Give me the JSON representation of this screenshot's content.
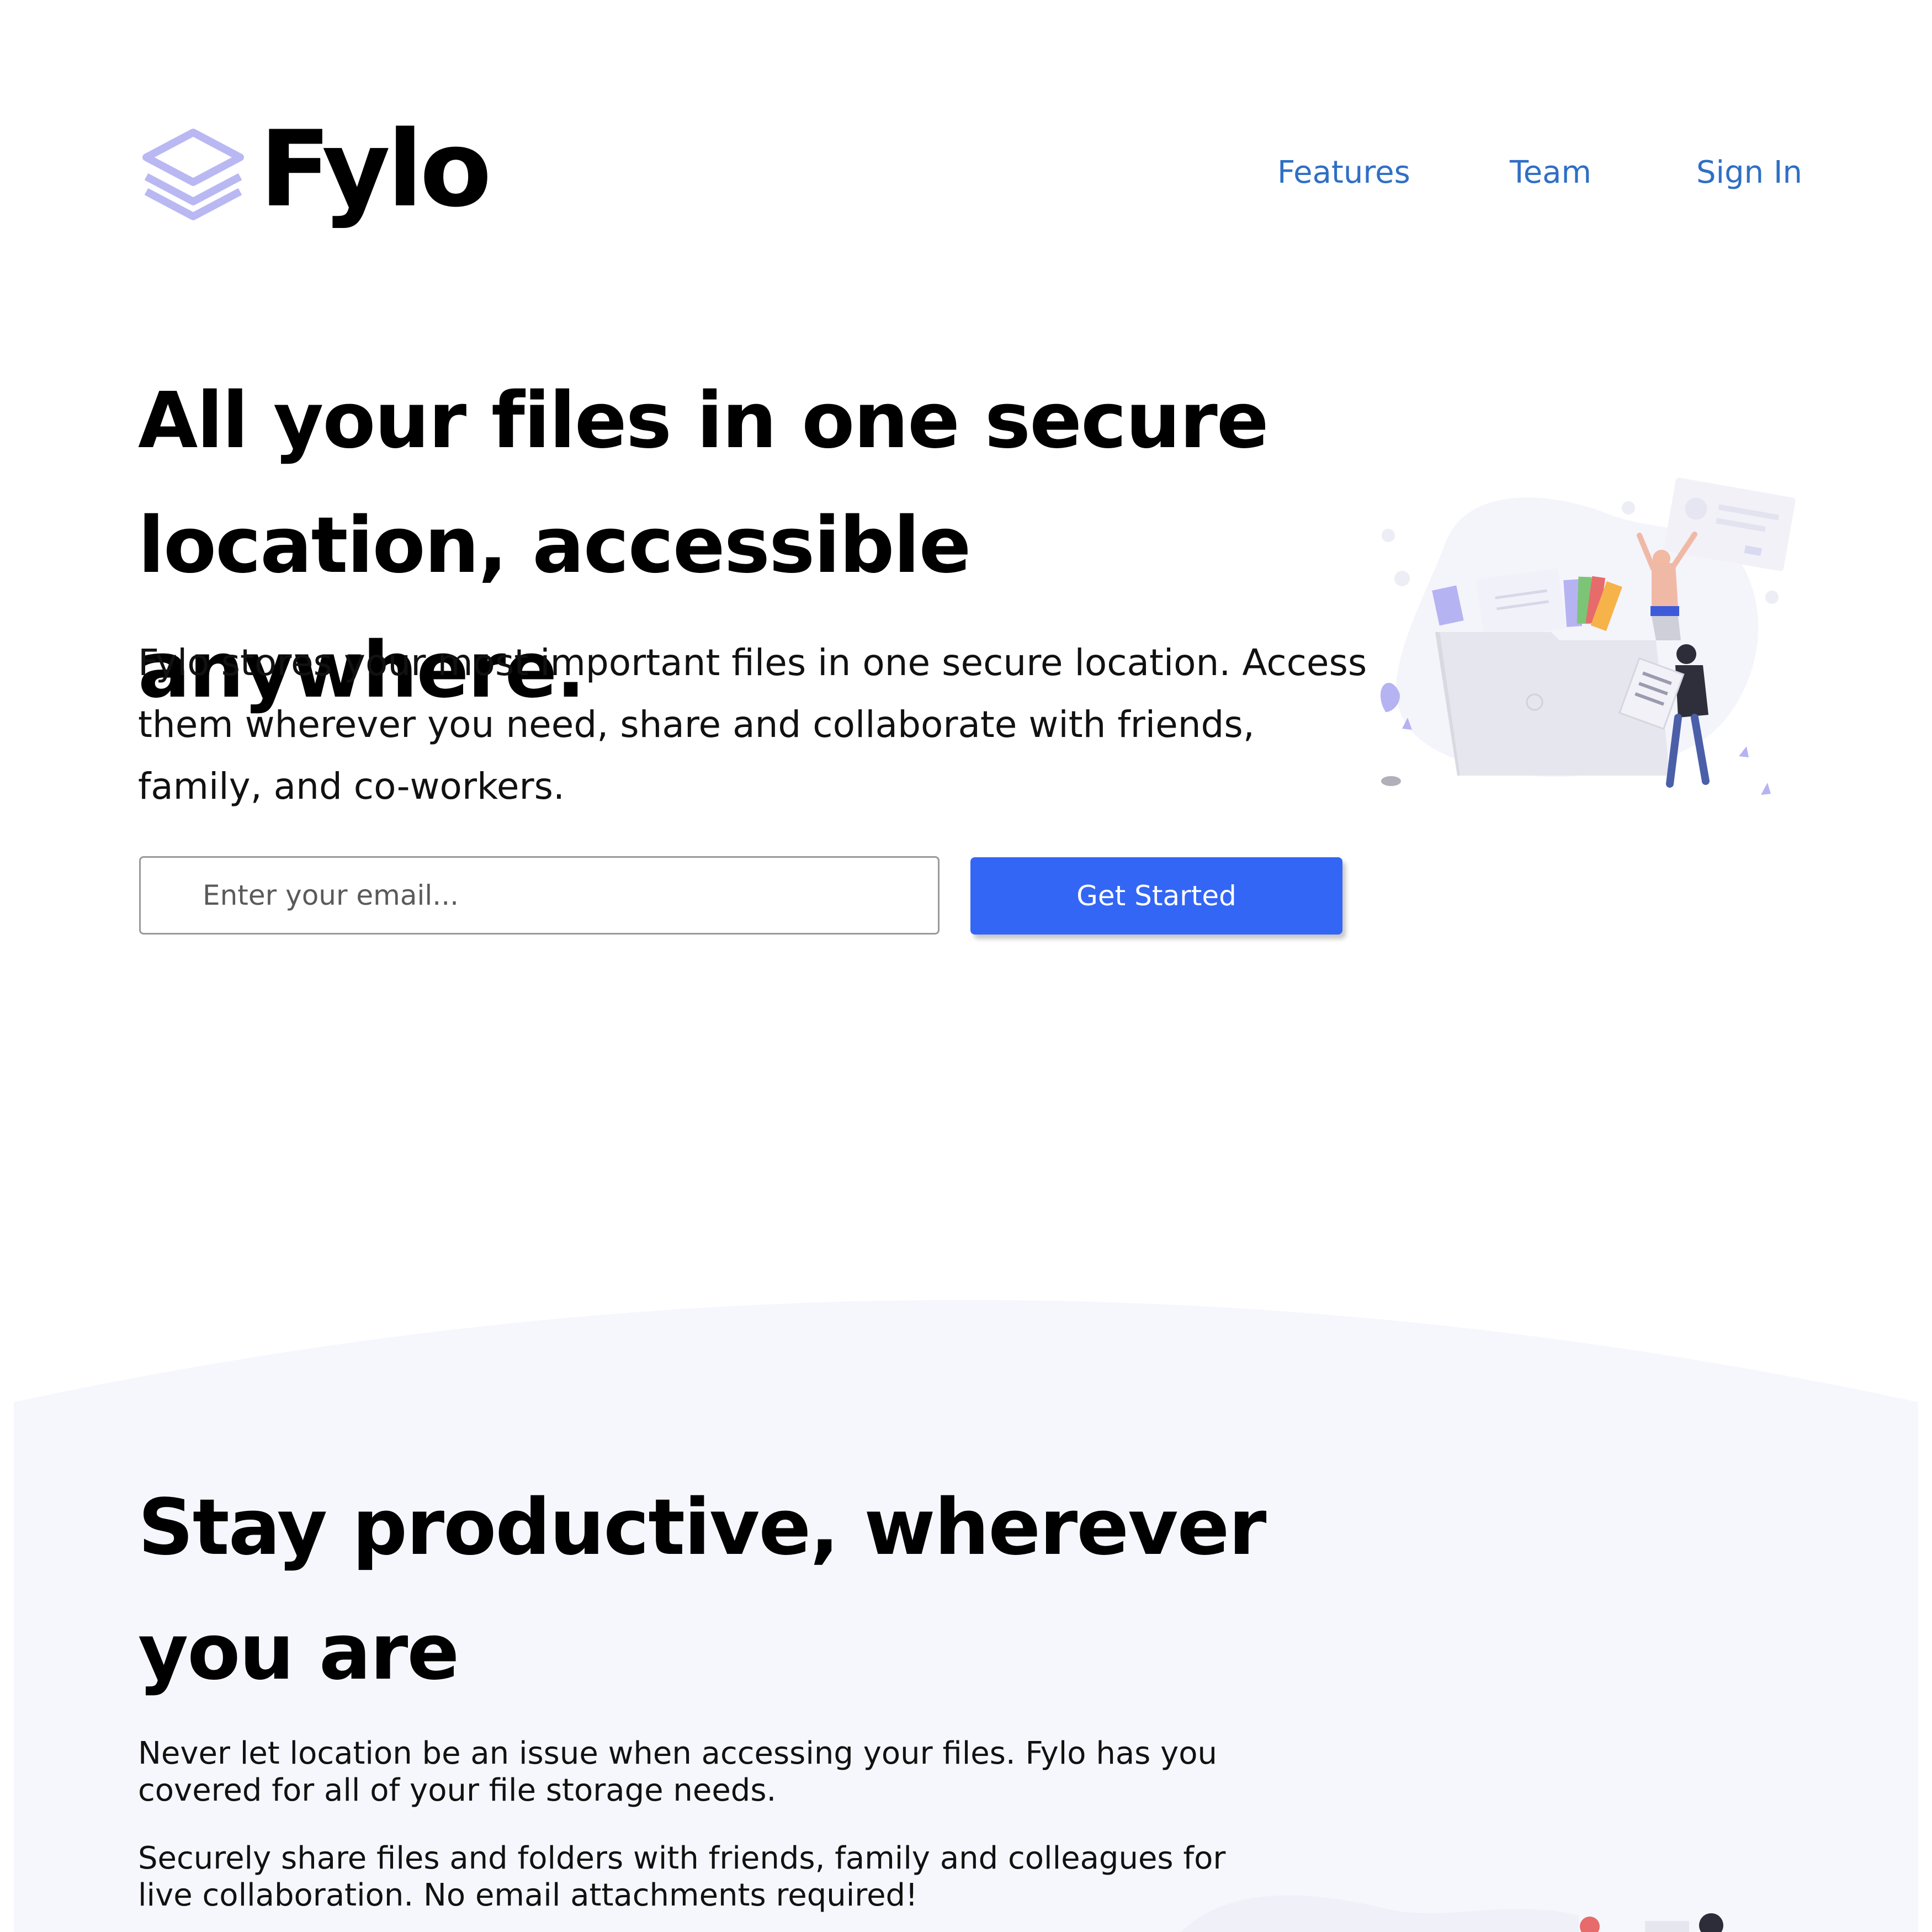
{
  "brand": {
    "name": "Fylo",
    "logo_icon": "stacked-layers-icon",
    "logo_color": "#b9b8f3"
  },
  "nav": {
    "items": [
      {
        "label": "Features"
      },
      {
        "label": "Team"
      },
      {
        "label": "Sign In"
      }
    ],
    "link_color": "#2f6fc5"
  },
  "hero": {
    "title": "All your files in one secure location, accessible anywhere.",
    "description": "Fylo stores your most important files in one secure location. Access them wherever you need, share and collaborate with friends, family, and co-workers.",
    "email_placeholder": "Enter your email...",
    "email_value": "",
    "cta_label": "Get Started",
    "cta_color": "#3366f5",
    "illustration": "people-filing-documents-illustration"
  },
  "productive": {
    "title": "Stay productive, wherever you are",
    "paragraph_1": "Never let location be an issue when accessing your files. Fylo has you covered for all of your file storage needs.",
    "paragraph_2": "Securely share files and folders with friends, family and colleagues for live collaboration. No email attachments required!",
    "background_color": "#f6f7fd",
    "illustration": "people-working-illustration"
  }
}
